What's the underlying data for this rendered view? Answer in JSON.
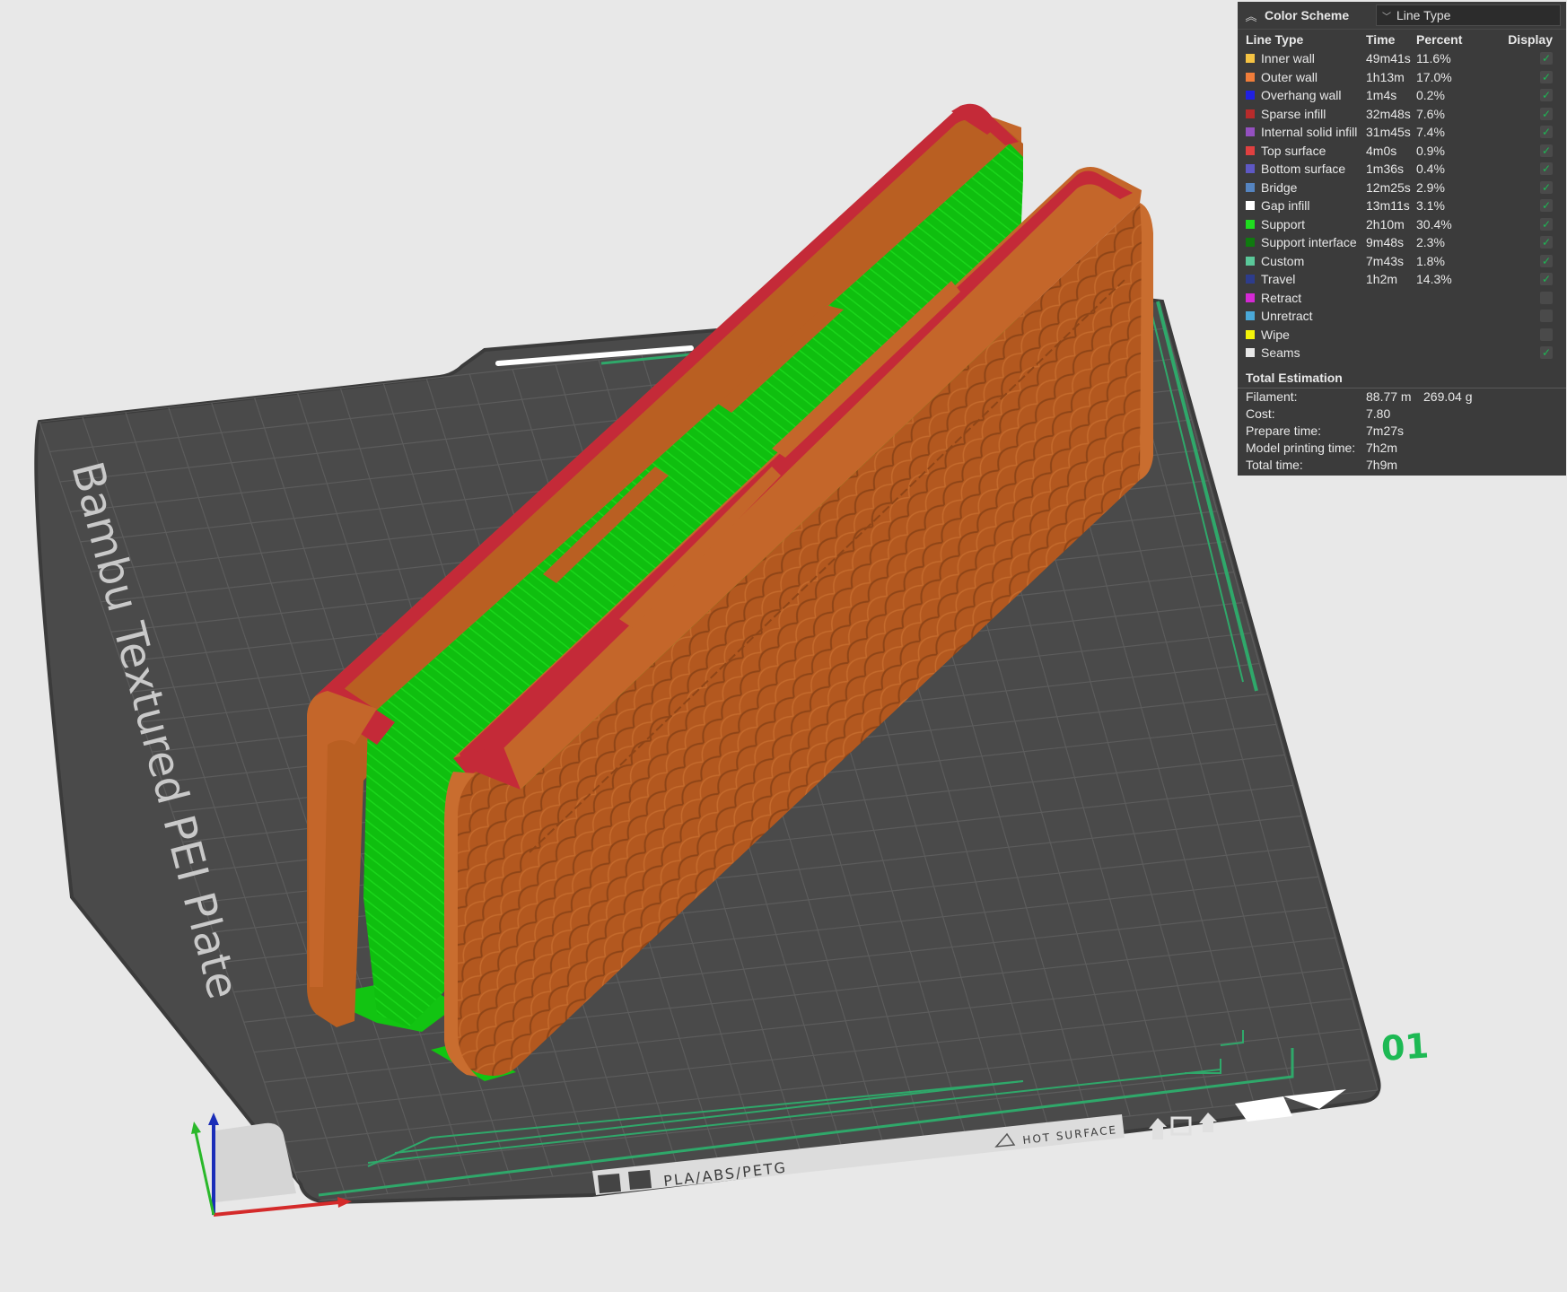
{
  "plate": {
    "name": "Bambu Textured PEI Plate",
    "materials": "PLA/ABS/PETG",
    "hot_surface": "HOT SURFACE",
    "number": "01"
  },
  "legend": {
    "title": "Color Scheme",
    "scheme": "Line Type",
    "columns": {
      "type": "Line Type",
      "time": "Time",
      "percent": "Percent",
      "display": "Display"
    },
    "items": [
      {
        "name": "Inner wall",
        "time": "49m41s",
        "percent": "11.6%",
        "color": "#f5c343",
        "shown": true
      },
      {
        "name": "Outer wall",
        "time": "1h13m",
        "percent": "17.0%",
        "color": "#f07d3a",
        "shown": true
      },
      {
        "name": "Overhang wall",
        "time": "1m4s",
        "percent": "0.2%",
        "color": "#2020e0",
        "shown": true
      },
      {
        "name": "Sparse infill",
        "time": "32m48s",
        "percent": "7.6%",
        "color": "#b82b2b",
        "shown": true
      },
      {
        "name": "Internal solid infill",
        "time": "31m45s",
        "percent": "7.4%",
        "color": "#9450c0",
        "shown": true
      },
      {
        "name": "Top surface",
        "time": "4m0s",
        "percent": "0.9%",
        "color": "#e04040",
        "shown": true
      },
      {
        "name": "Bottom surface",
        "time": "1m36s",
        "percent": "0.4%",
        "color": "#5e58c4",
        "shown": true
      },
      {
        "name": "Bridge",
        "time": "12m25s",
        "percent": "2.9%",
        "color": "#5584c0",
        "shown": true
      },
      {
        "name": "Gap infill",
        "time": "13m11s",
        "percent": "3.1%",
        "color": "#ffffff",
        "shown": true
      },
      {
        "name": "Support",
        "time": "2h10m",
        "percent": "30.4%",
        "color": "#1fdc1f",
        "shown": true
      },
      {
        "name": "Support interface",
        "time": "9m48s",
        "percent": "2.3%",
        "color": "#0f7a0f",
        "shown": true
      },
      {
        "name": "Custom",
        "time": "7m43s",
        "percent": "1.8%",
        "color": "#5ac89a",
        "shown": true
      },
      {
        "name": "Travel",
        "time": "1h2m",
        "percent": "14.3%",
        "color": "#2d3c8c",
        "shown": true
      },
      {
        "name": "Retract",
        "time": "",
        "percent": "",
        "color": "#d429d4",
        "shown": false
      },
      {
        "name": "Unretract",
        "time": "",
        "percent": "",
        "color": "#4aa8d8",
        "shown": false
      },
      {
        "name": "Wipe",
        "time": "",
        "percent": "",
        "color": "#f4f40a",
        "shown": false
      },
      {
        "name": "Seams",
        "time": "",
        "percent": "",
        "color": "#e8e8e8",
        "shown": true
      }
    ],
    "total": {
      "title": "Total Estimation",
      "rows": [
        {
          "label": "Filament:",
          "v1": "88.77 m",
          "v2": "269.04 g"
        },
        {
          "label": "Cost:",
          "v1": "7.80",
          "v2": ""
        },
        {
          "label": "Prepare time:",
          "v1": "7m27s",
          "v2": ""
        },
        {
          "label": "Model printing time:",
          "v1": "7h2m",
          "v2": ""
        },
        {
          "label": "Total time:",
          "v1": "7h9m",
          "v2": ""
        }
      ]
    }
  }
}
